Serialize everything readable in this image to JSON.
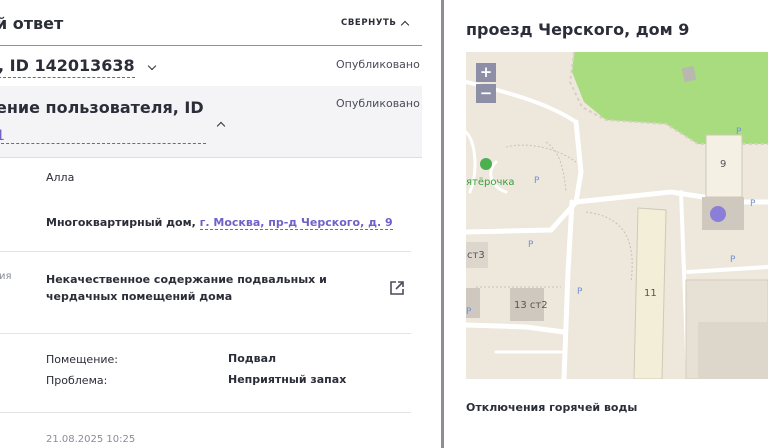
{
  "left": {
    "title": "й ответ",
    "collapse_label": "СВЕРНУТЬ",
    "record_id": ", ID 142013638",
    "status_1": "Опубликовано",
    "section2_title": "ение пользователя, ID",
    "section2_link": "1",
    "status_2": "Опубликовано",
    "user_name": "Алла",
    "object_type": "Многоквартирный дом, ",
    "object_address": "г. Москва, пр-д Черского, д. 9",
    "category_prefix": "ия",
    "problem_title": "Некачественное содержание подвальных и чердачных помещений дома",
    "room_label": "Помещение:",
    "room_value": "Подвал",
    "issue_label": "Проблема:",
    "issue_value": "Неприятный запах",
    "date": "21.08.2025 10:25"
  },
  "right": {
    "title": "проезд Черского, дом 9",
    "zoom_in": "+",
    "zoom_out": "−",
    "map_labels": {
      "store": "ятёрочка",
      "building_9": "9",
      "building_11": "11",
      "building_13": "13 ст2",
      "building_3": "ст3"
    },
    "hot_water_title": "Отключения горячей воды"
  },
  "colors": {
    "accent": "#6e62c8",
    "map_bg": "#ede7dc",
    "park": "#a9dc7e",
    "marker": "#8b7ed8"
  }
}
